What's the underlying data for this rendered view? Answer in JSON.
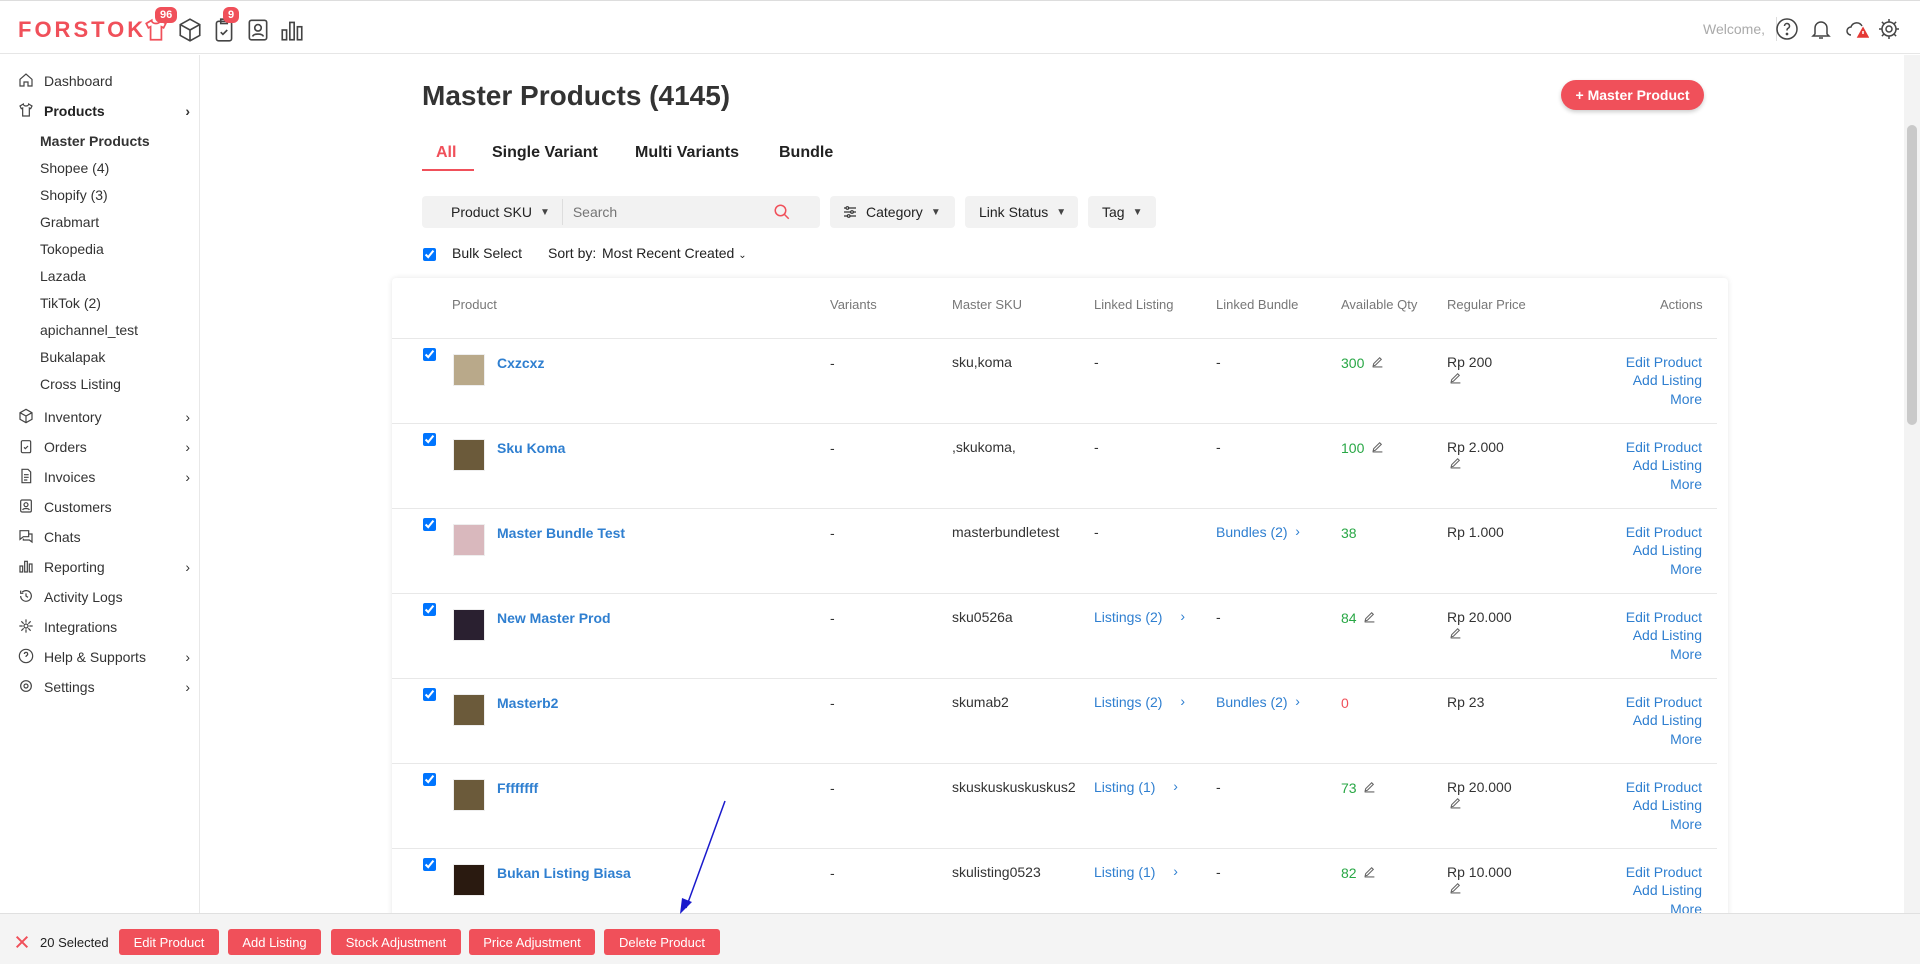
{
  "brand": {
    "logo": "FORSTOK",
    "accent": "#f0505a"
  },
  "topbar": {
    "icons": [
      {
        "name": "products-shirt-icon",
        "badge": "96"
      },
      {
        "name": "inventory-box-icon",
        "badge": ""
      },
      {
        "name": "orders-clipboard-icon",
        "badge": "9"
      },
      {
        "name": "contacts-icon",
        "badge": ""
      },
      {
        "name": "reporting-chart-icon",
        "badge": ""
      }
    ],
    "welcome": "Welcome,"
  },
  "sidebar": {
    "items": [
      {
        "label": "Dashboard",
        "icon": "home-icon",
        "expandable": false
      },
      {
        "label": "Products",
        "icon": "shirt-icon",
        "expandable": true
      },
      {
        "label": "Inventory",
        "icon": "box-icon",
        "expandable": true
      },
      {
        "label": "Orders",
        "icon": "clipboard-icon",
        "expandable": true
      },
      {
        "label": "Invoices",
        "icon": "invoice-icon",
        "expandable": true
      },
      {
        "label": "Customers",
        "icon": "customers-icon",
        "expandable": false
      },
      {
        "label": "Chats",
        "icon": "chat-icon",
        "expandable": false
      },
      {
        "label": "Reporting",
        "icon": "chart-icon",
        "expandable": true
      },
      {
        "label": "Activity Logs",
        "icon": "history-icon",
        "expandable": false
      },
      {
        "label": "Integrations",
        "icon": "integrations-icon",
        "expandable": false
      },
      {
        "label": "Help & Supports",
        "icon": "help-icon",
        "expandable": true
      },
      {
        "label": "Settings",
        "icon": "gear-icon",
        "expandable": true
      }
    ],
    "product_subitems": [
      "Master Products",
      "Shopee (4)",
      "Shopify (3)",
      "Grabmart",
      "Tokopedia",
      "Lazada",
      "TikTok (2)",
      "apichannel_test",
      "Bukalapak",
      "Cross Listing"
    ]
  },
  "page": {
    "title": "Master Products (4145)",
    "add_button": "+ Master Product",
    "tabs": [
      "All",
      "Single Variant",
      "Multi Variants",
      "Bundle"
    ],
    "active_tab": "All"
  },
  "filters": {
    "search_by": "Product SKU",
    "search_placeholder": "Search",
    "category": "Category",
    "link_status": "Link Status",
    "tag": "Tag",
    "bulk_select": "Bulk Select",
    "sort_label": "Sort by:",
    "sort_value": "Most Recent Created"
  },
  "table": {
    "headers": [
      "Product",
      "Variants",
      "Master SKU",
      "Linked Listing",
      "Linked Bundle",
      "Available Qty",
      "Regular Price",
      "Actions"
    ],
    "rows": [
      {
        "name": "Cxzcxz",
        "variants": "-",
        "sku": "sku,koma",
        "listing": "-",
        "bundle": "-",
        "qty": "300",
        "qty_color": "green",
        "qty_edit": true,
        "price": "Rp 200",
        "price_edit": true
      },
      {
        "name": "Sku Koma",
        "variants": "-",
        "sku": ",skukoma,",
        "listing": "-",
        "bundle": "-",
        "qty": "100",
        "qty_color": "green",
        "qty_edit": true,
        "price": "Rp 2.000",
        "price_edit": true
      },
      {
        "name": "Master Bundle Test",
        "variants": "-",
        "sku": "masterbundletest",
        "listing": "-",
        "bundle": "Bundles (2)",
        "qty": "38",
        "qty_color": "green",
        "qty_edit": false,
        "price": "Rp 1.000",
        "price_edit": false
      },
      {
        "name": "New Master Prod",
        "variants": "-",
        "sku": "sku0526a",
        "listing": "Listings (2)",
        "bundle": "-",
        "qty": "84",
        "qty_color": "green",
        "qty_edit": true,
        "price": "Rp 20.000",
        "price_edit": true
      },
      {
        "name": "Masterb2",
        "variants": "-",
        "sku": "skumab2",
        "listing": "Listings (2)",
        "bundle": "Bundles (2)",
        "qty": "0",
        "qty_color": "red",
        "qty_edit": false,
        "price": "Rp 23",
        "price_edit": false
      },
      {
        "name": "Ffffffff",
        "variants": "-",
        "sku": "skuskuskuskuskus2",
        "listing": "Listing (1)",
        "bundle": "-",
        "qty": "73",
        "qty_color": "green",
        "qty_edit": true,
        "price": "Rp 20.000",
        "price_edit": true
      },
      {
        "name": "Bukan Listing Biasa",
        "variants": "-",
        "sku": "skulisting0523",
        "listing": "Listing (1)",
        "bundle": "-",
        "qty": "82",
        "qty_color": "green",
        "qty_edit": true,
        "price": "Rp 10.000",
        "price_edit": true
      }
    ],
    "actions": [
      "Edit Product",
      "Add Listing",
      "More"
    ]
  },
  "bottom_bar": {
    "selected": "20 Selected",
    "buttons": [
      "Edit Product",
      "Add Listing",
      "Stock Adjustment",
      "Price Adjustment",
      "Delete Product"
    ]
  }
}
